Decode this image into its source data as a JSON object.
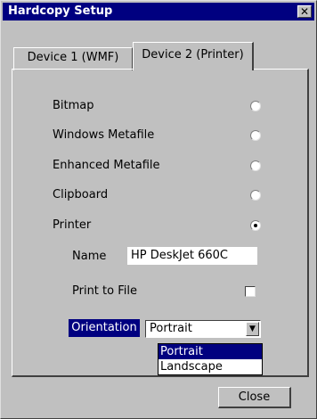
{
  "window": {
    "title": "Hardcopy Setup",
    "close_glyph": "✕"
  },
  "tabs": [
    {
      "label": "Device 1 (WMF)"
    },
    {
      "label": "Device 2 (Printer)"
    }
  ],
  "options": [
    {
      "label": "Bitmap",
      "selected": false
    },
    {
      "label": "Windows Metafile",
      "selected": false
    },
    {
      "label": "Enhanced Metafile",
      "selected": false
    },
    {
      "label": "Clipboard",
      "selected": false
    },
    {
      "label": "Printer",
      "selected": true
    }
  ],
  "printer": {
    "name_label": "Name",
    "name_value": "HP DeskJet 660C",
    "print_to_file_label": "Print to File",
    "print_to_file_checked": false
  },
  "orientation": {
    "label": "Orientation",
    "value": "Portrait",
    "options": [
      "Portrait",
      "Landscape"
    ],
    "arrow_glyph": "▼"
  },
  "buttons": {
    "close": "Close"
  }
}
